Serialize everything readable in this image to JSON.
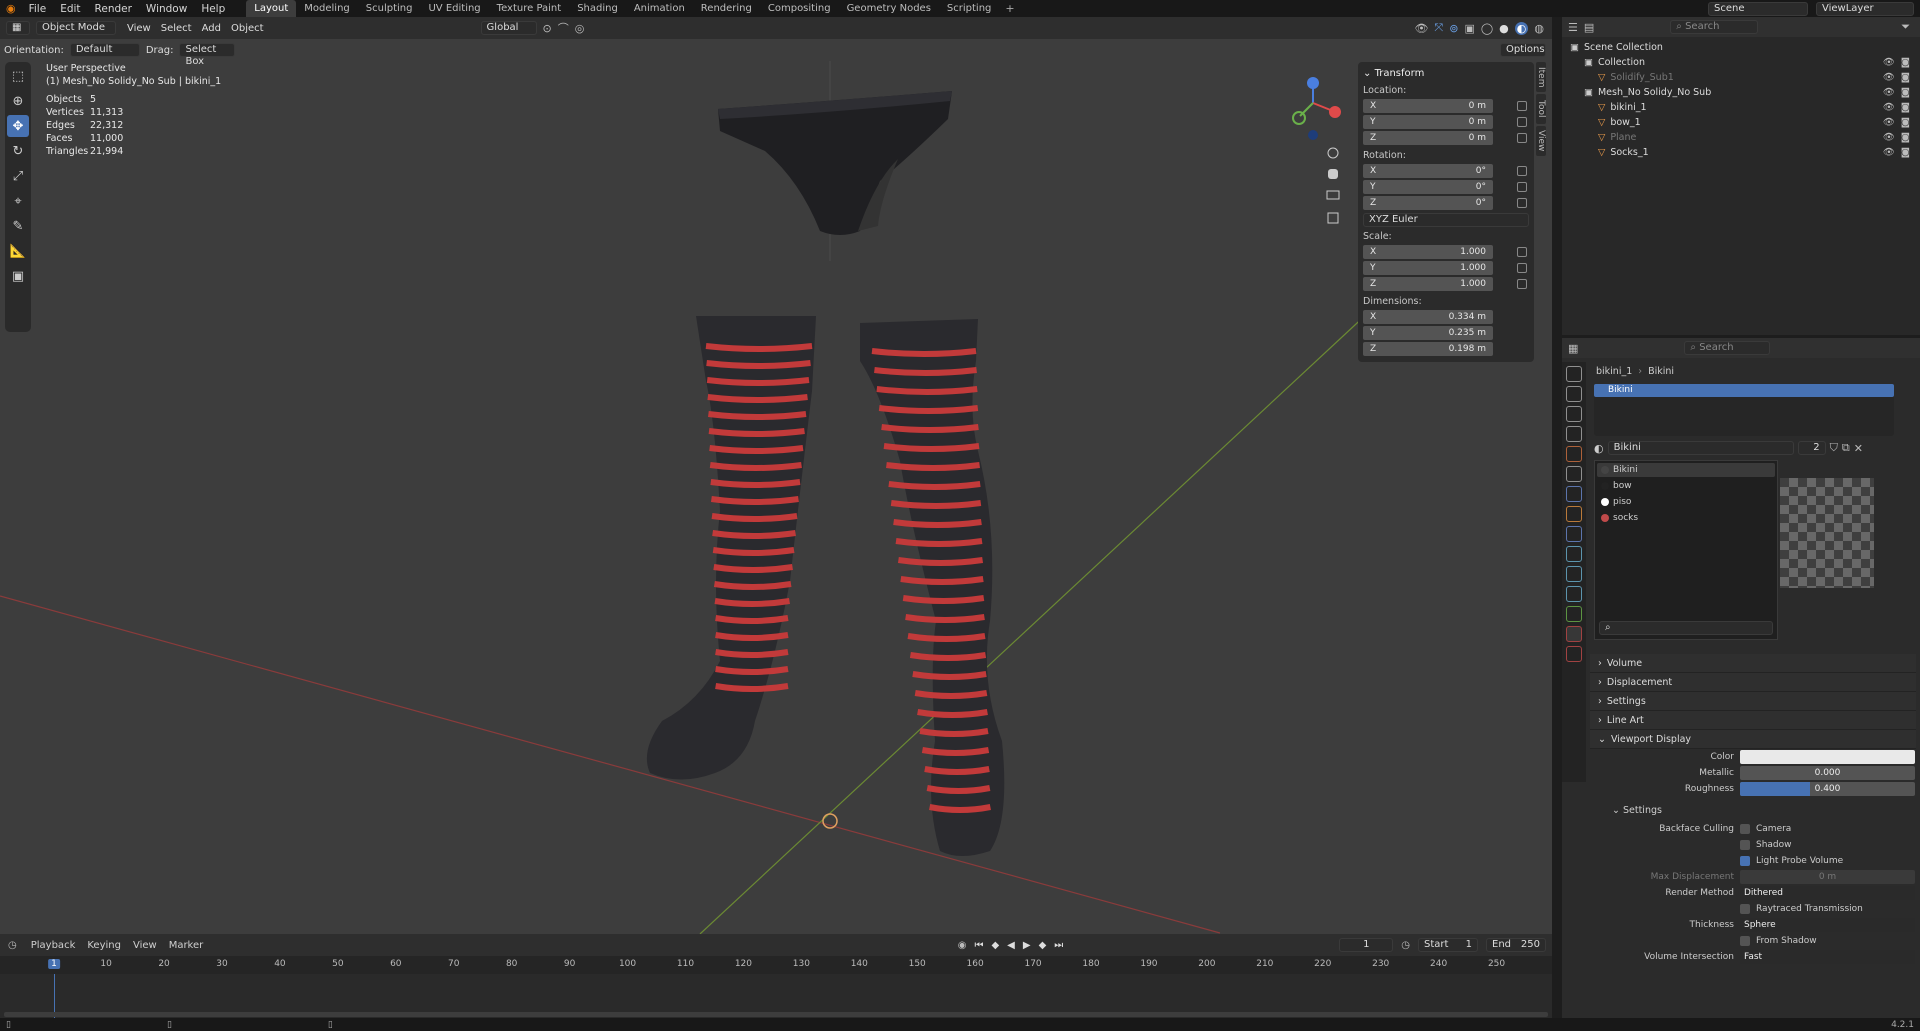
{
  "menu": {
    "items": [
      "File",
      "Edit",
      "Render",
      "Window",
      "Help"
    ]
  },
  "workspaces": [
    "Layout",
    "Modeling",
    "Sculpting",
    "UV Editing",
    "Texture Paint",
    "Shading",
    "Animation",
    "Rendering",
    "Compositing",
    "Geometry Nodes",
    "Scripting"
  ],
  "active_workspace": "Layout",
  "scene": {
    "name": "Scene",
    "view_layer": "ViewLayer"
  },
  "viewport_header": {
    "mode": "Object Mode",
    "menus": [
      "View",
      "Select",
      "Add",
      "Object"
    ],
    "transform_orientation": "Global",
    "orientation_label": "Orientation:",
    "orientation_value": "Default",
    "drag_label": "Drag:",
    "drag_value": "Select Box",
    "options": "Options"
  },
  "overlay": {
    "view_name": "User Perspective",
    "object_path": "(1) Mesh_No Solidy_No Sub | bikini_1",
    "stats": [
      {
        "k": "Objects",
        "v": "5"
      },
      {
        "k": "Vertices",
        "v": "11,313"
      },
      {
        "k": "Edges",
        "v": "22,312"
      },
      {
        "k": "Faces",
        "v": "11,000"
      },
      {
        "k": "Triangles",
        "v": "21,994"
      }
    ]
  },
  "npanel": {
    "title": "Transform",
    "location_label": "Location:",
    "location": [
      {
        "a": "X",
        "v": "0 m"
      },
      {
        "a": "Y",
        "v": "0 m"
      },
      {
        "a": "Z",
        "v": "0 m"
      }
    ],
    "rotation_label": "Rotation:",
    "rotation": [
      {
        "a": "X",
        "v": "0°"
      },
      {
        "a": "Y",
        "v": "0°"
      },
      {
        "a": "Z",
        "v": "0°"
      }
    ],
    "rotation_mode": "XYZ Euler",
    "scale_label": "Scale:",
    "scale": [
      {
        "a": "X",
        "v": "1.000"
      },
      {
        "a": "Y",
        "v": "1.000"
      },
      {
        "a": "Z",
        "v": "1.000"
      }
    ],
    "dimensions_label": "Dimensions:",
    "dimensions": [
      {
        "a": "X",
        "v": "0.334 m"
      },
      {
        "a": "Y",
        "v": "0.235 m"
      },
      {
        "a": "Z",
        "v": "0.198 m"
      }
    ],
    "tabs": [
      "Item",
      "Tool",
      "View"
    ]
  },
  "outliner": {
    "search_placeholder": "Search",
    "rows": [
      {
        "label": "Scene Collection",
        "indent": 0,
        "dim": false
      },
      {
        "label": "Collection",
        "indent": 1,
        "dim": false
      },
      {
        "label": "Solidify_Sub1",
        "indent": 2,
        "dim": true
      },
      {
        "label": "Mesh_No Solidy_No Sub",
        "indent": 1,
        "dim": false
      },
      {
        "label": "bikini_1",
        "indent": 2,
        "dim": false
      },
      {
        "label": "bow_1",
        "indent": 2,
        "dim": false
      },
      {
        "label": "Plane",
        "indent": 2,
        "dim": true
      },
      {
        "label": "Socks_1",
        "indent": 2,
        "dim": false
      }
    ]
  },
  "properties": {
    "search_placeholder": "Search",
    "breadcrumb_object": "bikini_1",
    "breadcrumb_material": "Bikini",
    "slot_selected": "Bikini",
    "material_name": "Bikini",
    "user_count": "2",
    "material_list": [
      "Bikini",
      "bow",
      "piso",
      "socks"
    ],
    "sections": [
      "Volume",
      "Displacement",
      "Settings",
      "Line Art",
      "Viewport Display"
    ],
    "viewport_display": {
      "color_label": "Color",
      "metallic_label": "Metallic",
      "metallic": "0.000",
      "roughness_label": "Roughness",
      "roughness": "0.400",
      "roughness_fraction": 0.4
    },
    "settings_title": "Settings",
    "backface_label": "Backface Culling",
    "camera": "Camera",
    "shadow": "Shadow",
    "light_probe": "Light Probe Volume",
    "max_disp_label": "Max Displacement",
    "max_disp": "0 m",
    "render_method_label": "Render Method",
    "render_method": "Dithered",
    "raytraced": "Raytraced Transmission",
    "thickness_label": "Thickness",
    "thickness": "Sphere",
    "from_shadow": "From Shadow",
    "volume_int_label": "Volume Intersection",
    "volume_int": "Fast"
  },
  "timeline": {
    "menus": [
      "Playback",
      "Keying",
      "View",
      "Marker"
    ],
    "current_frame": "1",
    "start_label": "Start",
    "start": "1",
    "end_label": "End",
    "end": "250",
    "ticks": [
      "1",
      "10",
      "20",
      "30",
      "40",
      "50",
      "60",
      "70",
      "80",
      "90",
      "100",
      "110",
      "120",
      "130",
      "140",
      "150",
      "160",
      "170",
      "180",
      "190",
      "200",
      "210",
      "220",
      "230",
      "240",
      "250"
    ]
  },
  "status": {
    "version": "4.2.1"
  }
}
